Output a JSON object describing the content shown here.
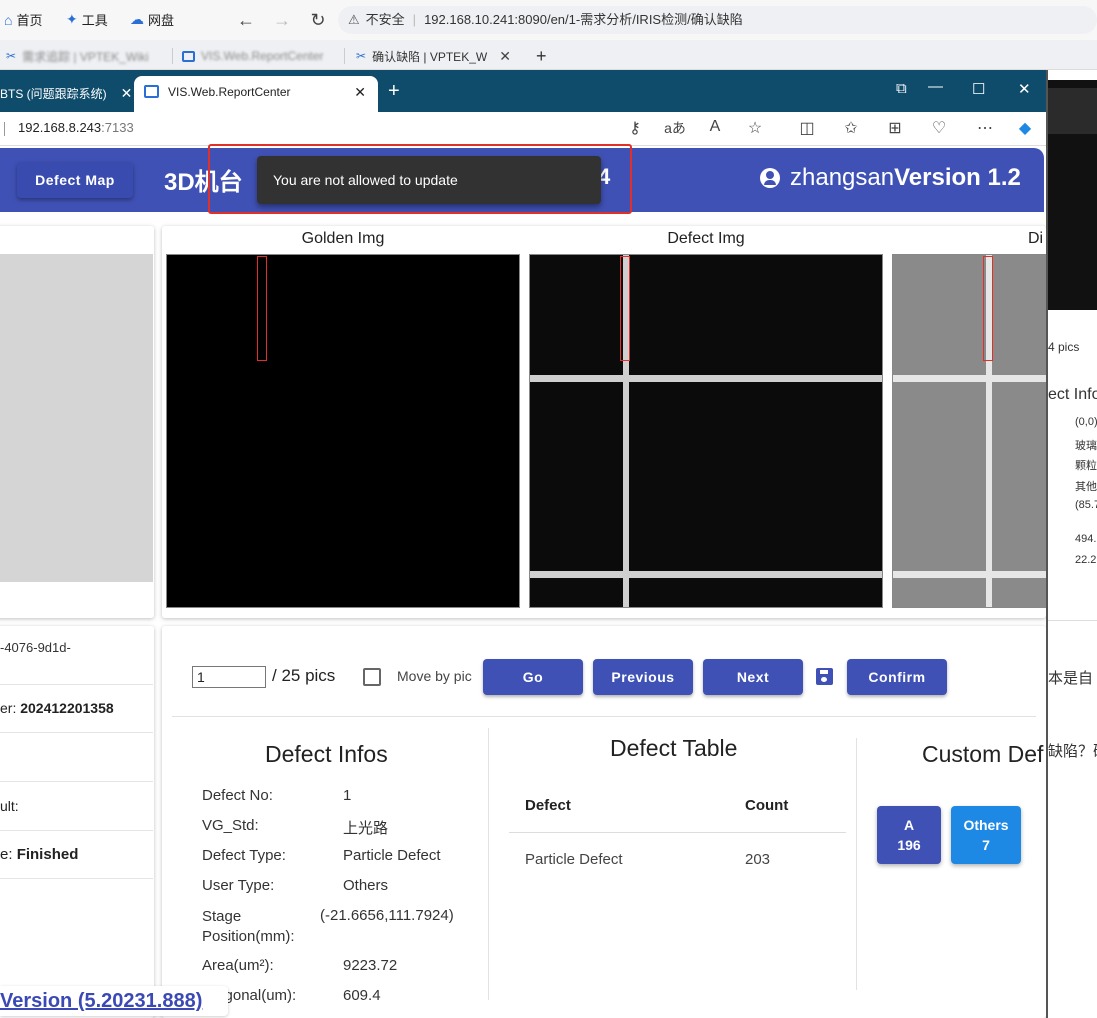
{
  "outer_browser": {
    "bookmarks": [
      {
        "label": "首页",
        "icon": "home-icon"
      },
      {
        "label": "工具",
        "icon": "sparkle-icon"
      },
      {
        "label": "网盘",
        "icon": "cloud-icon"
      }
    ],
    "security_label": "不安全",
    "url": "192.168.10.241:8090/en/1-需求分析/IRIS检测/确认缺陷",
    "tabs": [
      {
        "label": "需求追踪 | VPTEK_Wiki"
      },
      {
        "label": "VIS.Web.ReportCenter"
      },
      {
        "label": "确认缺陷 | VPTEK_W"
      }
    ]
  },
  "inner_browser": {
    "tab1_label": "BTS (问题跟踪系统)",
    "tab2_label": "VIS.Web.ReportCenter",
    "url_host": "192.168.8.243",
    "url_port": ":7133"
  },
  "header": {
    "defect_map_label": "Defect Map",
    "title": "3D机台",
    "title_tail": "4",
    "username": "zhangsan",
    "version": "Version 1.2"
  },
  "toast": {
    "message": "You are not allowed to update"
  },
  "images": {
    "golden_title": "Golden Img",
    "defect_title": "Defect Img",
    "diff_title": "Di"
  },
  "left_info": {
    "id_fragment": "-4076-9d1d-",
    "batch_label": "er:",
    "batch_value": "202412201358",
    "result_label": "ult:",
    "status_label": "e:",
    "status_value": "Finished"
  },
  "controls": {
    "page_value": "1",
    "total_pics": "/ 25 pics",
    "move_by_pic_label": "Move by pic",
    "go_label": "Go",
    "previous_label": "Previous",
    "next_label": "Next",
    "confirm_label": "Confirm"
  },
  "defect_infos": {
    "title": "Defect Infos",
    "rows": [
      {
        "label": "Defect No:",
        "value": "1"
      },
      {
        "label": "VG_Std:",
        "value": "上光路"
      },
      {
        "label": "Defect Type:",
        "value": "Particle Defect"
      },
      {
        "label": "User Type:",
        "value": "Others"
      },
      {
        "label": "Stage Position(mm):",
        "value": "(-21.6656,111.7924)"
      },
      {
        "label": "Area(um²):",
        "value": "9223.72"
      },
      {
        "label": "Diagonal(um):",
        "value": "609.4"
      }
    ]
  },
  "defect_table": {
    "title": "Defect Table",
    "col_defect": "Defect",
    "col_count": "Count",
    "rows": [
      {
        "defect": "Particle Defect",
        "count": "203"
      }
    ]
  },
  "custom_defect": {
    "title": "Custom Def",
    "buttons": [
      {
        "name": "A",
        "count": "196",
        "color": "#3f51b5"
      },
      {
        "name": "Others",
        "count": "7",
        "color": "#1e88e5"
      }
    ]
  },
  "bottom_link": "Version (5.20231.888)",
  "background_window": {
    "pics": "4 pics",
    "info_title": "ect Info",
    "lines": [
      "(0,0)",
      "玻璃",
      "颗粒",
      "其他",
      "(85.7",
      "494.",
      "22.2"
    ],
    "text1": "本是自",
    "text2": "缺陷？确"
  }
}
